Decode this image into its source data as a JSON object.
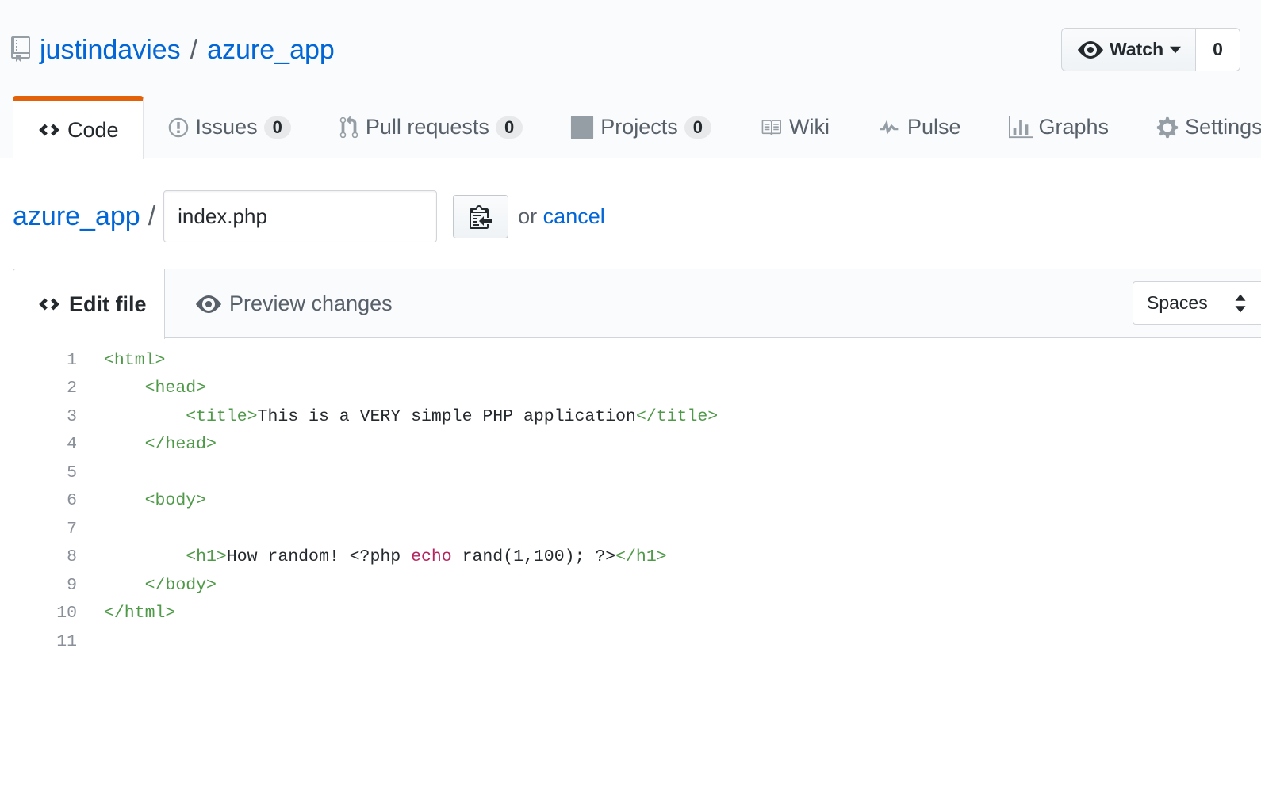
{
  "repo": {
    "owner": "justindavies",
    "separator": "/",
    "name": "azure_app"
  },
  "watch": {
    "label": "Watch",
    "count": "0"
  },
  "nav": [
    {
      "label": "Code",
      "icon": "code-icon",
      "selected": true
    },
    {
      "label": "Issues",
      "icon": "issue-icon",
      "count": "0"
    },
    {
      "label": "Pull requests",
      "icon": "pull-request-icon",
      "count": "0"
    },
    {
      "label": "Projects",
      "icon": "project-icon",
      "count": "0"
    },
    {
      "label": "Wiki",
      "icon": "book-icon"
    },
    {
      "label": "Pulse",
      "icon": "pulse-icon"
    },
    {
      "label": "Graphs",
      "icon": "graph-icon"
    },
    {
      "label": "Settings",
      "icon": "gear-icon"
    }
  ],
  "breadcrumb": {
    "repo": "azure_app",
    "separator": "/",
    "filename": "index.php",
    "or_text": "or",
    "cancel": "cancel"
  },
  "editor": {
    "tab_edit": "Edit file",
    "tab_preview": "Preview changes",
    "indent_mode": "Spaces",
    "lines": [
      {
        "n": "1",
        "parts": [
          {
            "t": "<html>",
            "c": "tag"
          }
        ]
      },
      {
        "n": "2",
        "parts": [
          {
            "t": "    "
          },
          {
            "t": "<head>",
            "c": "tag"
          }
        ]
      },
      {
        "n": "3",
        "parts": [
          {
            "t": "        "
          },
          {
            "t": "<title>",
            "c": "tag"
          },
          {
            "t": "This is a VERY simple PHP application"
          },
          {
            "t": "</title>",
            "c": "tag"
          }
        ]
      },
      {
        "n": "4",
        "parts": [
          {
            "t": "    "
          },
          {
            "t": "</head>",
            "c": "tag"
          }
        ]
      },
      {
        "n": "5",
        "parts": []
      },
      {
        "n": "6",
        "parts": [
          {
            "t": "    "
          },
          {
            "t": "<body>",
            "c": "tag"
          }
        ]
      },
      {
        "n": "7",
        "parts": []
      },
      {
        "n": "8",
        "parts": [
          {
            "t": "        "
          },
          {
            "t": "<h1>",
            "c": "tag"
          },
          {
            "t": "How random! <?php "
          },
          {
            "t": "echo",
            "c": "kw"
          },
          {
            "t": " rand(1,100); ?>"
          },
          {
            "t": "</h1>",
            "c": "tag"
          }
        ]
      },
      {
        "n": "9",
        "parts": [
          {
            "t": "    "
          },
          {
            "t": "</body>",
            "c": "tag"
          }
        ]
      },
      {
        "n": "10",
        "parts": [
          {
            "t": "</html>",
            "c": "tag"
          }
        ]
      },
      {
        "n": "11",
        "parts": []
      }
    ]
  }
}
